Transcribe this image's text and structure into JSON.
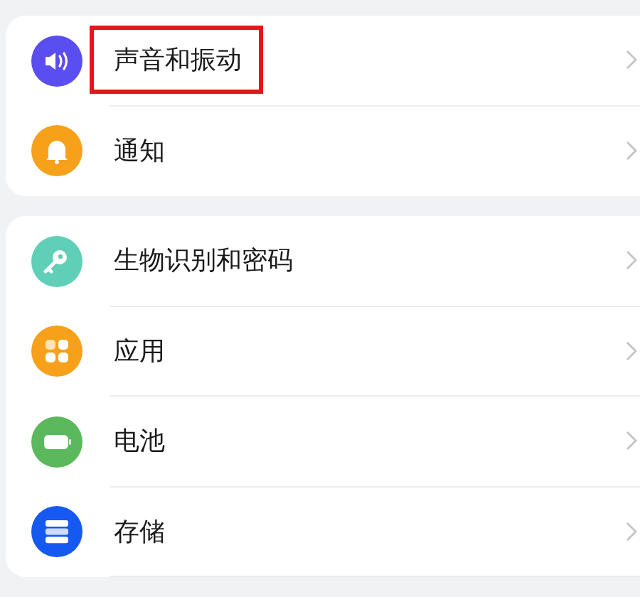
{
  "sections": [
    {
      "items": [
        {
          "label": "声音和振动",
          "kind": "sound",
          "highlighted": true
        },
        {
          "label": "通知",
          "kind": "bell",
          "highlighted": false
        }
      ]
    },
    {
      "items": [
        {
          "label": "生物识别和密码",
          "kind": "key",
          "highlighted": false
        },
        {
          "label": "应用",
          "kind": "apps",
          "highlighted": false
        },
        {
          "label": "电池",
          "kind": "battery",
          "highlighted": false
        },
        {
          "label": "存储",
          "kind": "storage",
          "highlighted": false
        }
      ]
    }
  ]
}
